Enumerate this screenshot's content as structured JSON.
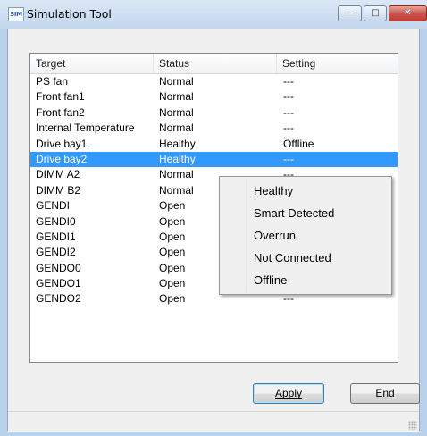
{
  "window": {
    "title": "Simulation Tool",
    "icon_text": "SIM",
    "minimize_glyph": "–",
    "maximize_glyph": "□",
    "close_glyph": "✕"
  },
  "list": {
    "columns": [
      "Target",
      "Status",
      "Setting"
    ],
    "rows": [
      {
        "target": "PS fan",
        "status": "Normal",
        "setting": "---"
      },
      {
        "target": "Front fan1",
        "status": "Normal",
        "setting": "---"
      },
      {
        "target": "Front fan2",
        "status": "Normal",
        "setting": "---"
      },
      {
        "target": "Internal Temperature",
        "status": "Normal",
        "setting": "---"
      },
      {
        "target": "Drive bay1",
        "status": "Healthy",
        "setting": "Offline"
      },
      {
        "target": "Drive bay2",
        "status": "Healthy",
        "setting": "---",
        "selected": true
      },
      {
        "target": "DIMM A2",
        "status": "Normal",
        "setting": "---"
      },
      {
        "target": "DIMM B2",
        "status": "Normal",
        "setting": "---"
      },
      {
        "target": "GENDI",
        "status": "Open",
        "setting": "---"
      },
      {
        "target": "GENDI0",
        "status": "Open",
        "setting": "---"
      },
      {
        "target": "GENDI1",
        "status": "Open",
        "setting": "---"
      },
      {
        "target": "GENDI2",
        "status": "Open",
        "setting": "---"
      },
      {
        "target": "GENDO0",
        "status": "Open",
        "setting": "---"
      },
      {
        "target": "GENDO1",
        "status": "Open",
        "setting": "---"
      },
      {
        "target": "GENDO2",
        "status": "Open",
        "setting": "---"
      }
    ]
  },
  "context_menu": {
    "items": [
      "Healthy",
      "Smart Detected",
      "Overrun",
      "Not Connected",
      "Offline"
    ]
  },
  "buttons": {
    "apply": "Apply",
    "end": "End"
  },
  "colors": {
    "selection": "#3399ff",
    "close_button": "#c75050"
  }
}
